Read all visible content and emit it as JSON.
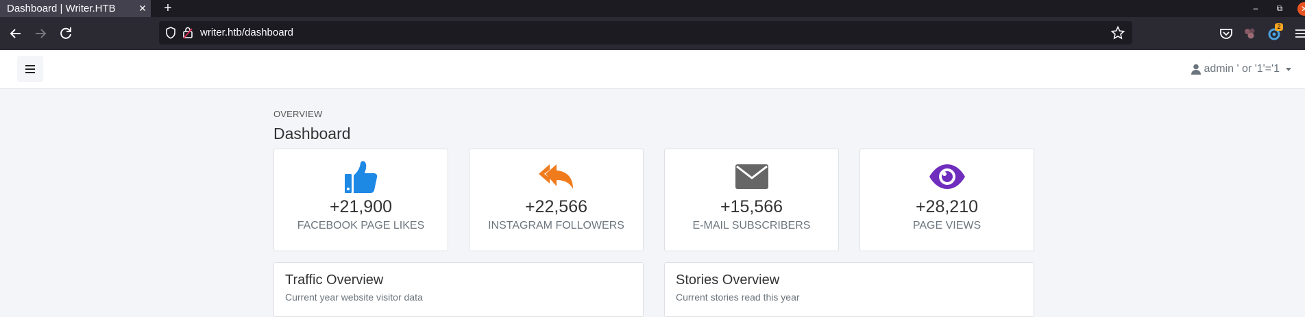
{
  "browser": {
    "tab_title": "Dashboard | Writer.HTB",
    "tab_close": "✕",
    "new_tab": "+",
    "window_minimize": "–",
    "window_restore": "⧉",
    "window_close": "✕",
    "url": "writer.htb/dashboard",
    "extension_badge": "2"
  },
  "header": {
    "user_name": "admin ' or '1'='1"
  },
  "page": {
    "eyebrow": "OVERVIEW",
    "title": "Dashboard"
  },
  "stats": [
    {
      "icon": "thumbs-up-icon",
      "value": "+21,900",
      "label": "Facebook Page Likes",
      "color": "#1e88e5"
    },
    {
      "icon": "reply-all-icon",
      "value": "+22,566",
      "label": "Instagram Followers",
      "color": "#f07b1d"
    },
    {
      "icon": "envelope-icon",
      "value": "+15,566",
      "label": "E-Mail Subscribers",
      "color": "#666666"
    },
    {
      "icon": "eye-icon",
      "value": "+28,210",
      "label": "Page Views",
      "color": "#6f2dbd"
    }
  ],
  "panels": [
    {
      "title": "Traffic Overview",
      "subtitle": "Current year website visitor data"
    },
    {
      "title": "Stories Overview",
      "subtitle": "Current stories read this year"
    }
  ]
}
